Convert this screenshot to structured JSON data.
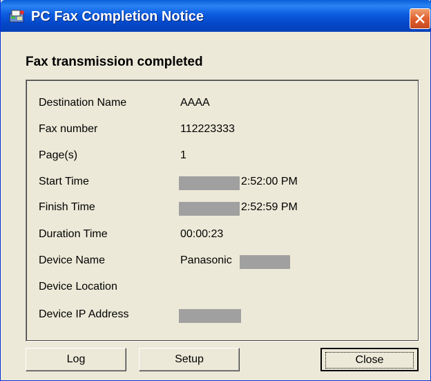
{
  "window": {
    "title": "PC Fax Completion Notice",
    "icon": "fax-app-icon",
    "close_icon": "close-icon"
  },
  "heading": "Fax transmission completed",
  "details": [
    {
      "label": "Destination Name",
      "value": "AAAA",
      "redacted": false
    },
    {
      "label": "Fax number",
      "value": "112223333",
      "redacted": false
    },
    {
      "label": "Page(s)",
      "value": "1",
      "redacted": false
    },
    {
      "label": "Start Time",
      "value": "2:52:00 PM",
      "redacted": "before"
    },
    {
      "label": "Finish Time",
      "value": "2:52:59 PM",
      "redacted": "before"
    },
    {
      "label": "Duration Time",
      "value": "00:00:23",
      "redacted": false
    },
    {
      "label": "Device Name",
      "value": "Panasonic",
      "redacted": "after"
    },
    {
      "label": "Device Location",
      "value": "",
      "redacted": false
    },
    {
      "label": "Device IP Address",
      "value": "",
      "redacted": "full"
    }
  ],
  "buttons": {
    "log": "Log",
    "setup": "Setup",
    "close": "Close"
  },
  "colors": {
    "titlebar": "#0c5ce0",
    "dialog_bg": "#ece9d8",
    "redaction": "#a0a0a0",
    "close_button": "#e06030"
  }
}
